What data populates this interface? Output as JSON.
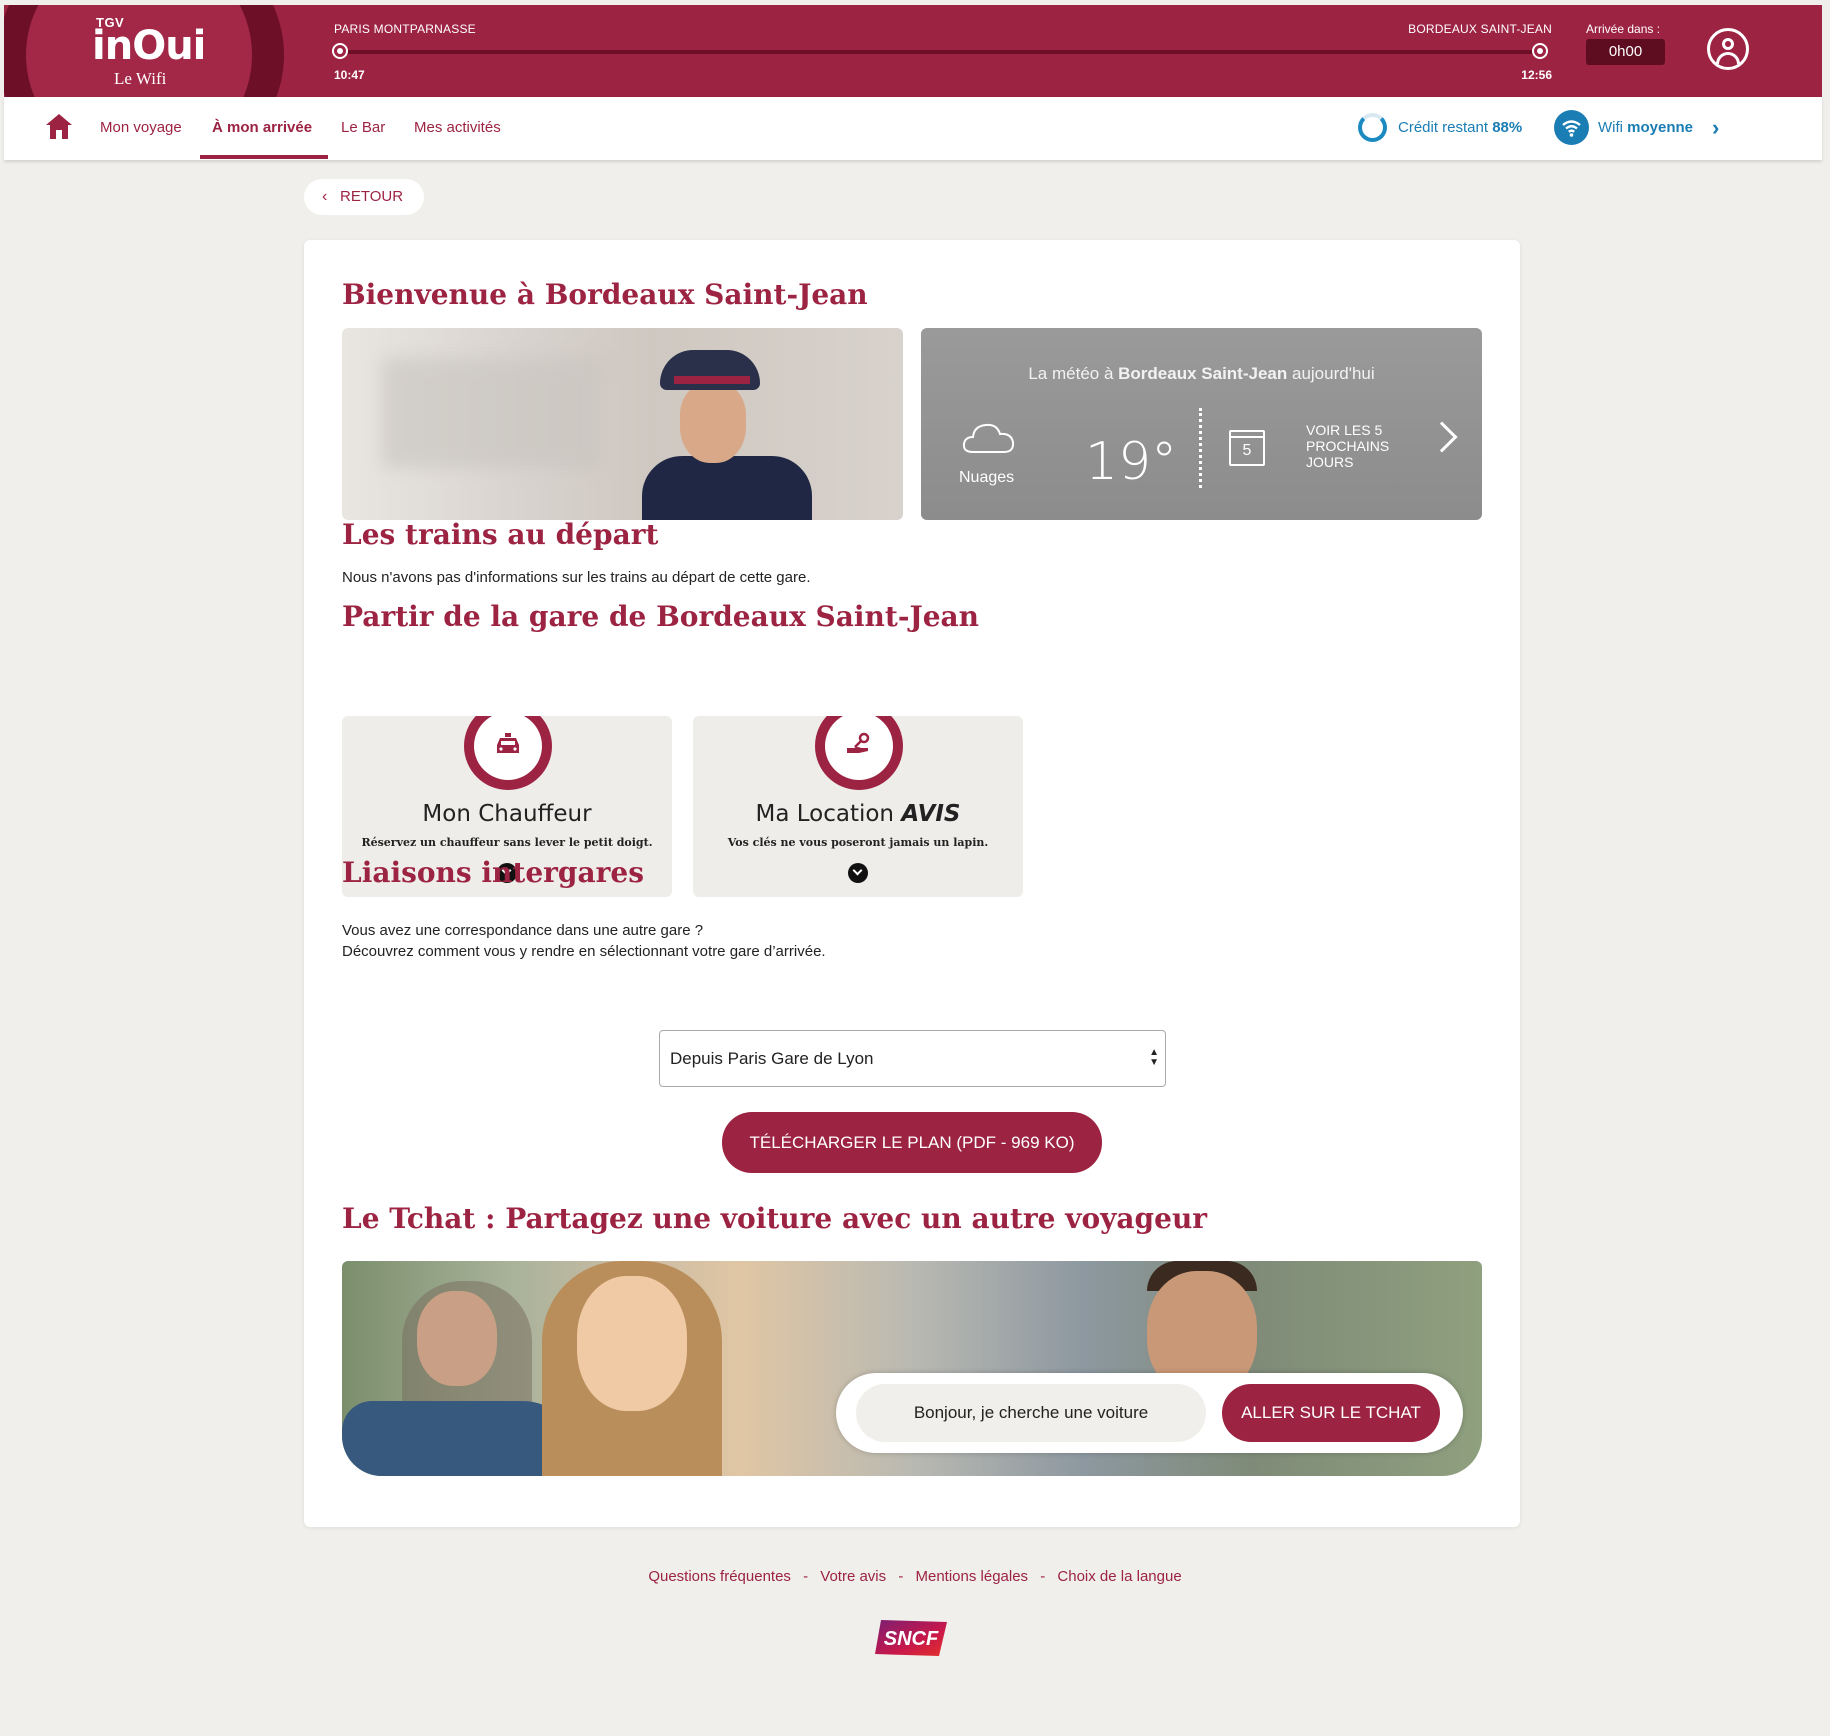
{
  "header": {
    "logo_brand_small": "TGV",
    "logo_brand": "inOui",
    "logo_subtitle": "Le Wifi",
    "departure_station": "PARIS MONTPARNASSE",
    "departure_time": "10:47",
    "arrival_station": "BORDEAUX SAINT-JEAN",
    "arrival_time": "12:56",
    "arrival_in_label": "Arrivée dans :",
    "arrival_in_value": "0h00",
    "progress": 1.0,
    "colors": {
      "brand": "#9c2342",
      "brand_dark": "#6d0f27",
      "accent_blue": "#1a7db3"
    }
  },
  "nav": {
    "items": [
      {
        "label": "Mon voyage"
      },
      {
        "label": "À mon arrivée",
        "active": true
      },
      {
        "label": "Le Bar"
      },
      {
        "label": "Mes activités"
      }
    ],
    "credit_label": "Crédit restant",
    "credit_value": "88%",
    "wifi_label": "Wifi",
    "wifi_value": "moyenne"
  },
  "back_label": "RETOUR",
  "welcome": {
    "title": "Bienvenue à Bordeaux Saint-Jean"
  },
  "weather": {
    "prefix": "La météo à",
    "station": "Bordeaux Saint-Jean",
    "suffix": "aujourd'hui",
    "condition": "Nuages",
    "temperature": "19°",
    "calendar_day": "5",
    "forecast_link": "VOIR LES 5 PROCHAINS JOURS"
  },
  "departures": {
    "title": "Les trains au départ",
    "message": "Nous n'avons pas d'informations sur les trains au départ de cette gare."
  },
  "leave": {
    "title": "Partir de la gare de Bordeaux Saint-Jean",
    "tiles": [
      {
        "name": "Mon Chauffeur",
        "brand": "",
        "icon": "taxi-icon",
        "description": "Réservez un chauffeur sans lever le petit doigt."
      },
      {
        "name": "Ma Location",
        "brand": "AVIS",
        "icon": "car-key-icon",
        "description": "Vos clés ne vous poseront jamais un lapin."
      }
    ]
  },
  "interstation": {
    "title": "Liaisons intergares",
    "line1": "Vous avez une correspondance dans une autre gare ?",
    "line2": "Découvrez comment vous y rendre en sélectionnant votre gare d’arrivée.",
    "selected": "Depuis Paris Gare de Lyon",
    "download_label": "TÉLÉCHARGER LE PLAN (PDF - 969 KO)"
  },
  "chat": {
    "title": "Le Tchat : Partagez une voiture avec un autre voyageur",
    "input_text": "Bonjour, je cherche une voiture",
    "button_label": "ALLER SUR LE TCHAT"
  },
  "footer": {
    "links": [
      "Questions fréquentes",
      "Votre avis",
      "Mentions légales",
      "Choix de la langue"
    ],
    "separator": "-",
    "logo_text": "SNCF"
  }
}
